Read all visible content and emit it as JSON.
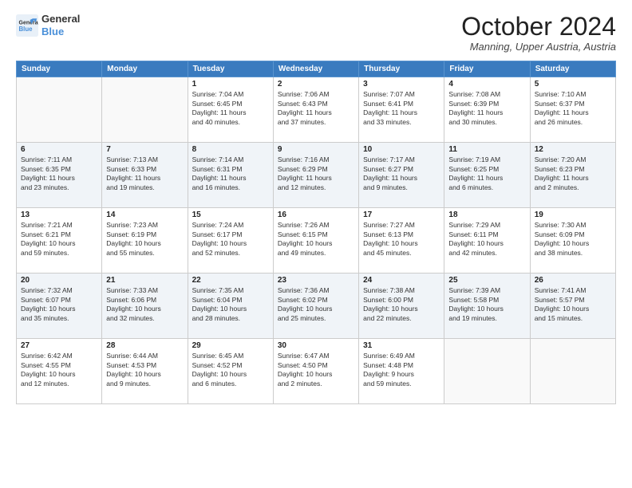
{
  "header": {
    "logo_line1": "General",
    "logo_line2": "Blue",
    "month": "October 2024",
    "location": "Manning, Upper Austria, Austria"
  },
  "weekdays": [
    "Sunday",
    "Monday",
    "Tuesday",
    "Wednesday",
    "Thursday",
    "Friday",
    "Saturday"
  ],
  "weeks": [
    [
      {
        "day": "",
        "info": ""
      },
      {
        "day": "",
        "info": ""
      },
      {
        "day": "1",
        "info": "Sunrise: 7:04 AM\nSunset: 6:45 PM\nDaylight: 11 hours\nand 40 minutes."
      },
      {
        "day": "2",
        "info": "Sunrise: 7:06 AM\nSunset: 6:43 PM\nDaylight: 11 hours\nand 37 minutes."
      },
      {
        "day": "3",
        "info": "Sunrise: 7:07 AM\nSunset: 6:41 PM\nDaylight: 11 hours\nand 33 minutes."
      },
      {
        "day": "4",
        "info": "Sunrise: 7:08 AM\nSunset: 6:39 PM\nDaylight: 11 hours\nand 30 minutes."
      },
      {
        "day": "5",
        "info": "Sunrise: 7:10 AM\nSunset: 6:37 PM\nDaylight: 11 hours\nand 26 minutes."
      }
    ],
    [
      {
        "day": "6",
        "info": "Sunrise: 7:11 AM\nSunset: 6:35 PM\nDaylight: 11 hours\nand 23 minutes."
      },
      {
        "day": "7",
        "info": "Sunrise: 7:13 AM\nSunset: 6:33 PM\nDaylight: 11 hours\nand 19 minutes."
      },
      {
        "day": "8",
        "info": "Sunrise: 7:14 AM\nSunset: 6:31 PM\nDaylight: 11 hours\nand 16 minutes."
      },
      {
        "day": "9",
        "info": "Sunrise: 7:16 AM\nSunset: 6:29 PM\nDaylight: 11 hours\nand 12 minutes."
      },
      {
        "day": "10",
        "info": "Sunrise: 7:17 AM\nSunset: 6:27 PM\nDaylight: 11 hours\nand 9 minutes."
      },
      {
        "day": "11",
        "info": "Sunrise: 7:19 AM\nSunset: 6:25 PM\nDaylight: 11 hours\nand 6 minutes."
      },
      {
        "day": "12",
        "info": "Sunrise: 7:20 AM\nSunset: 6:23 PM\nDaylight: 11 hours\nand 2 minutes."
      }
    ],
    [
      {
        "day": "13",
        "info": "Sunrise: 7:21 AM\nSunset: 6:21 PM\nDaylight: 10 hours\nand 59 minutes."
      },
      {
        "day": "14",
        "info": "Sunrise: 7:23 AM\nSunset: 6:19 PM\nDaylight: 10 hours\nand 55 minutes."
      },
      {
        "day": "15",
        "info": "Sunrise: 7:24 AM\nSunset: 6:17 PM\nDaylight: 10 hours\nand 52 minutes."
      },
      {
        "day": "16",
        "info": "Sunrise: 7:26 AM\nSunset: 6:15 PM\nDaylight: 10 hours\nand 49 minutes."
      },
      {
        "day": "17",
        "info": "Sunrise: 7:27 AM\nSunset: 6:13 PM\nDaylight: 10 hours\nand 45 minutes."
      },
      {
        "day": "18",
        "info": "Sunrise: 7:29 AM\nSunset: 6:11 PM\nDaylight: 10 hours\nand 42 minutes."
      },
      {
        "day": "19",
        "info": "Sunrise: 7:30 AM\nSunset: 6:09 PM\nDaylight: 10 hours\nand 38 minutes."
      }
    ],
    [
      {
        "day": "20",
        "info": "Sunrise: 7:32 AM\nSunset: 6:07 PM\nDaylight: 10 hours\nand 35 minutes."
      },
      {
        "day": "21",
        "info": "Sunrise: 7:33 AM\nSunset: 6:06 PM\nDaylight: 10 hours\nand 32 minutes."
      },
      {
        "day": "22",
        "info": "Sunrise: 7:35 AM\nSunset: 6:04 PM\nDaylight: 10 hours\nand 28 minutes."
      },
      {
        "day": "23",
        "info": "Sunrise: 7:36 AM\nSunset: 6:02 PM\nDaylight: 10 hours\nand 25 minutes."
      },
      {
        "day": "24",
        "info": "Sunrise: 7:38 AM\nSunset: 6:00 PM\nDaylight: 10 hours\nand 22 minutes."
      },
      {
        "day": "25",
        "info": "Sunrise: 7:39 AM\nSunset: 5:58 PM\nDaylight: 10 hours\nand 19 minutes."
      },
      {
        "day": "26",
        "info": "Sunrise: 7:41 AM\nSunset: 5:57 PM\nDaylight: 10 hours\nand 15 minutes."
      }
    ],
    [
      {
        "day": "27",
        "info": "Sunrise: 6:42 AM\nSunset: 4:55 PM\nDaylight: 10 hours\nand 12 minutes."
      },
      {
        "day": "28",
        "info": "Sunrise: 6:44 AM\nSunset: 4:53 PM\nDaylight: 10 hours\nand 9 minutes."
      },
      {
        "day": "29",
        "info": "Sunrise: 6:45 AM\nSunset: 4:52 PM\nDaylight: 10 hours\nand 6 minutes."
      },
      {
        "day": "30",
        "info": "Sunrise: 6:47 AM\nSunset: 4:50 PM\nDaylight: 10 hours\nand 2 minutes."
      },
      {
        "day": "31",
        "info": "Sunrise: 6:49 AM\nSunset: 4:48 PM\nDaylight: 9 hours\nand 59 minutes."
      },
      {
        "day": "",
        "info": ""
      },
      {
        "day": "",
        "info": ""
      }
    ]
  ]
}
